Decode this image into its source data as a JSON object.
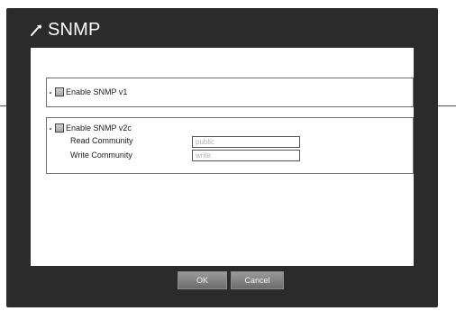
{
  "dialog": {
    "title": "SNMP",
    "icon": "wrench-icon"
  },
  "snmp_v1": {
    "label": "Enable SNMP v1",
    "checked": false
  },
  "snmp_v2c": {
    "label": "Enable SNMP v2c",
    "checked": false,
    "read_community_label": "Read Community",
    "read_community_value": "public",
    "write_community_label": "Write Community",
    "write_community_value": "write"
  },
  "buttons": {
    "ok": "OK",
    "cancel": "Cancel"
  }
}
